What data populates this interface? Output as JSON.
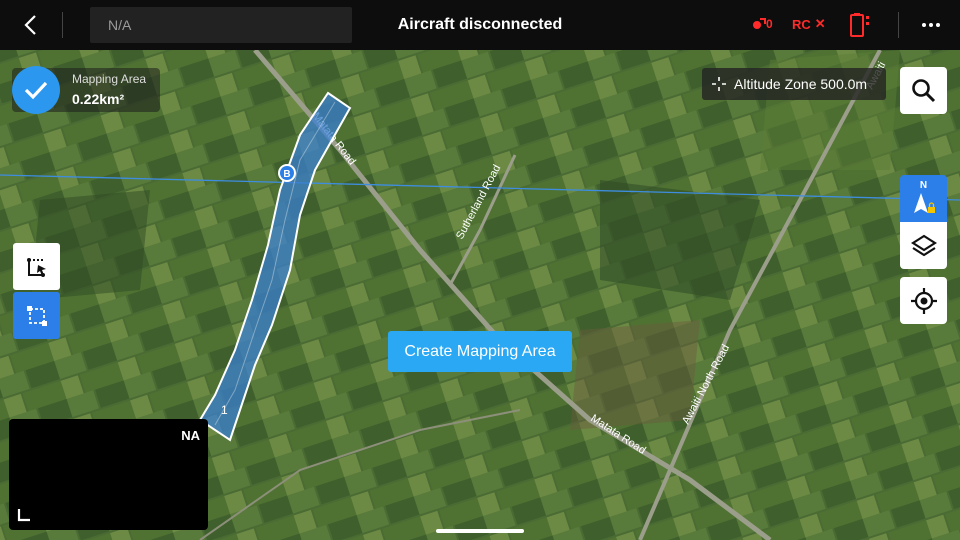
{
  "topbar": {
    "status_text": "N/A",
    "title": "Aircraft disconnected",
    "drone_count": "0",
    "rc_label": "RC",
    "rc_mark": "✕"
  },
  "mapping_area": {
    "label": "Mapping Area",
    "value": "0.22km²"
  },
  "altitude_zone": {
    "text": "Altitude Zone 500.0m"
  },
  "compass": {
    "north_label": "N"
  },
  "actions": {
    "create_label": "Create Mapping Area"
  },
  "fpv": {
    "label": "NA"
  },
  "map": {
    "polygon_start_label": "B",
    "polygon_end_label": "1",
    "roads": [
      "Matata Road",
      "Sutherland Road",
      "Awaiti North Road",
      "Matata Road"
    ],
    "road_top_right": "Awaiti"
  },
  "colors": {
    "accent_blue": "#2c97ee",
    "create_button": "#2aa8f3",
    "alert_red": "#ff2a2a",
    "polygon_fill": "#3a7fd0"
  }
}
